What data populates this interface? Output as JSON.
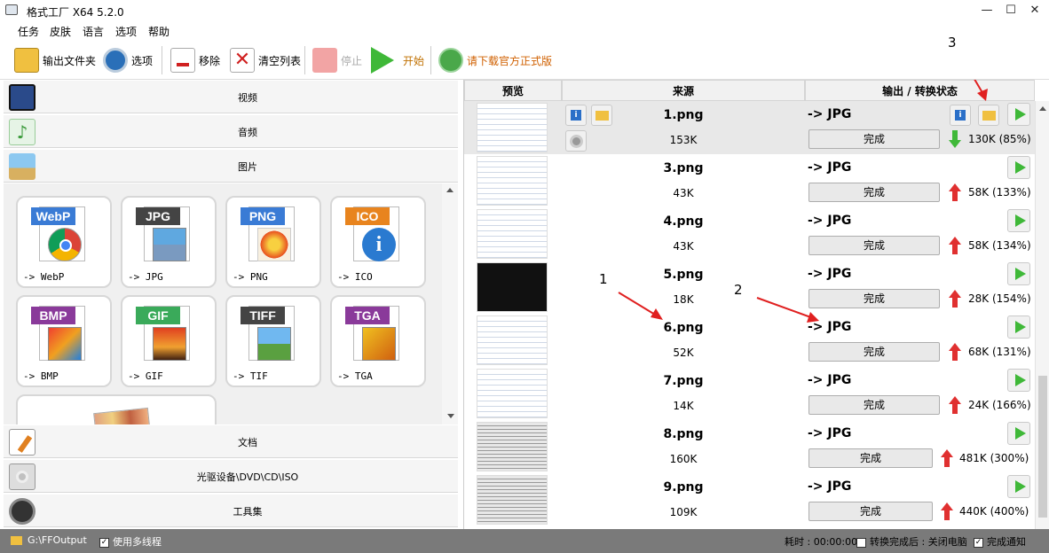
{
  "app": {
    "title": "格式工厂 X64 5.2.0"
  },
  "window": {
    "minimize": "—",
    "maximize": "☐",
    "close": "✕"
  },
  "menu": [
    "任务",
    "皮肤",
    "语言",
    "选项",
    "帮助"
  ],
  "toolbar": {
    "output_folder": "输出文件夹",
    "options": "选项",
    "remove": "移除",
    "clear_list": "清空列表",
    "stop": "停止",
    "start": "开始",
    "download": "请下载官方正式版"
  },
  "categories": {
    "video": "视频",
    "audio": "音频",
    "image": "图片",
    "document": "文档",
    "disc": "光驱设备\\DVD\\CD\\ISO",
    "tools": "工具集"
  },
  "formats": [
    {
      "badge": "WebP",
      "label": "-> WebP",
      "color": "#3a7bd5"
    },
    {
      "badge": "JPG",
      "label": "-> JPG",
      "color": "#444444"
    },
    {
      "badge": "PNG",
      "label": "-> PNG",
      "color": "#3a7bd5"
    },
    {
      "badge": "ICO",
      "label": "-> ICO",
      "color": "#e8841e"
    },
    {
      "badge": "BMP",
      "label": "-> BMP",
      "color": "#8a3a9a"
    },
    {
      "badge": "GIF",
      "label": "-> GIF",
      "color": "#3aaa5a"
    },
    {
      "badge": "TIFF",
      "label": "-> TIF",
      "color": "#444444"
    },
    {
      "badge": "TGA",
      "label": "-> TGA",
      "color": "#8a3a9a"
    }
  ],
  "table": {
    "headers": {
      "preview": "预览",
      "source": "来源",
      "output": "输出 / 转换状态"
    },
    "rows": [
      {
        "name": "1.png",
        "size": "153K",
        "fmt": "-> JPG",
        "status": "完成",
        "out": "130K",
        "pct": "(85%)",
        "dir": "down"
      },
      {
        "name": "3.png",
        "size": "43K",
        "fmt": "-> JPG",
        "status": "完成",
        "out": "58K",
        "pct": "(133%)",
        "dir": "up"
      },
      {
        "name": "4.png",
        "size": "43K",
        "fmt": "-> JPG",
        "status": "完成",
        "out": "58K",
        "pct": "(134%)",
        "dir": "up"
      },
      {
        "name": "5.png",
        "size": "18K",
        "fmt": "-> JPG",
        "status": "完成",
        "out": "28K",
        "pct": "(154%)",
        "dir": "up"
      },
      {
        "name": "6.png",
        "size": "52K",
        "fmt": "-> JPG",
        "status": "完成",
        "out": "68K",
        "pct": "(131%)",
        "dir": "up"
      },
      {
        "name": "7.png",
        "size": "14K",
        "fmt": "-> JPG",
        "status": "完成",
        "out": "24K",
        "pct": "(166%)",
        "dir": "up"
      },
      {
        "name": "8.png",
        "size": "160K",
        "fmt": "-> JPG",
        "status": "完成",
        "out": "481K",
        "pct": "(300%)",
        "dir": "up"
      },
      {
        "name": "9.png",
        "size": "109K",
        "fmt": "-> JPG",
        "status": "完成",
        "out": "440K",
        "pct": "(400%)",
        "dir": "up"
      }
    ]
  },
  "status": {
    "output_path": "G:\\FFOutput",
    "multithread": "使用多线程",
    "elapsed": "耗时 : 00:00:00",
    "after_convert": "转换完成后 : 关闭电脑",
    "notify": "完成通知"
  },
  "annotations": [
    "1",
    "2",
    "3"
  ],
  "colors": {
    "up_arrow": "#e03030",
    "down_arrow": "#3fb838",
    "play": "#3fb838",
    "status_bar": "#7a7a7a",
    "annotation_arrow": "#e02020"
  }
}
